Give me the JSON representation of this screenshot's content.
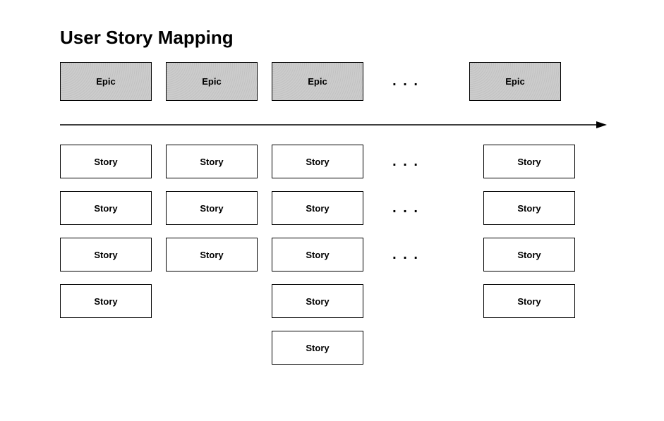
{
  "title": "User Story Mapping",
  "epic_label": "Epic",
  "story_label": "Story",
  "ellipsis": ". . .",
  "columns": [
    {
      "epic": true,
      "stories": 4
    },
    {
      "epic": true,
      "stories": 3
    },
    {
      "epic": true,
      "stories": 5
    },
    {
      "ellipsis": true,
      "stories": 3
    },
    {
      "epic": true,
      "stories": 4
    }
  ]
}
